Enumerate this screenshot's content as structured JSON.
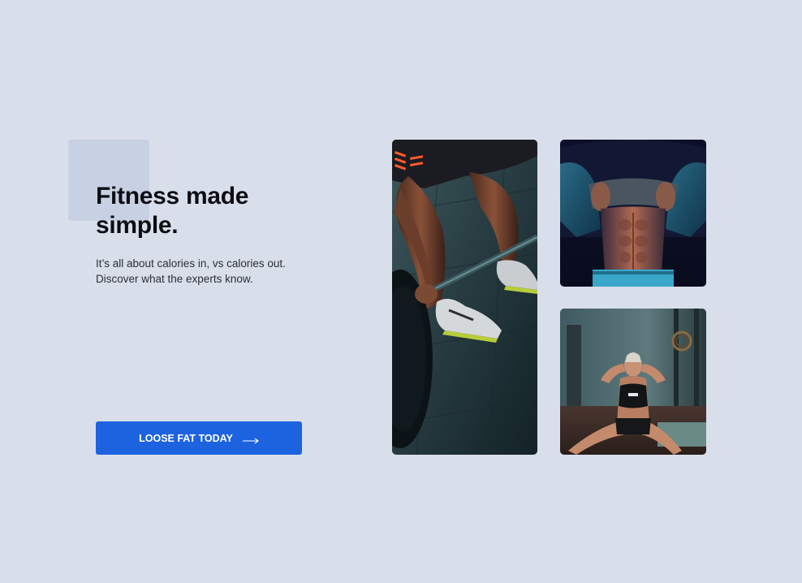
{
  "hero": {
    "title": "Fitness made simple.",
    "description": "It’s all about calories in, vs calories out. Discover what the experts know."
  },
  "cta": {
    "label": "LOOSE FAT TODAY",
    "icon": "arrow-right-icon"
  },
  "gallery": [
    {
      "name": "deadlift-photo",
      "depicts": "athlete gripping a loaded barbell"
    },
    {
      "name": "abs-photo",
      "depicts": "man lifting shirt to show abdominal muscles"
    },
    {
      "name": "situp-photo",
      "depicts": "woman doing sit-ups in a gym"
    }
  ],
  "colors": {
    "background": "#d9dfea",
    "decor_square": "#c8d1e3",
    "accent": "#1d63e0",
    "title": "#0d0e14",
    "body_text": "#2a2d36"
  }
}
